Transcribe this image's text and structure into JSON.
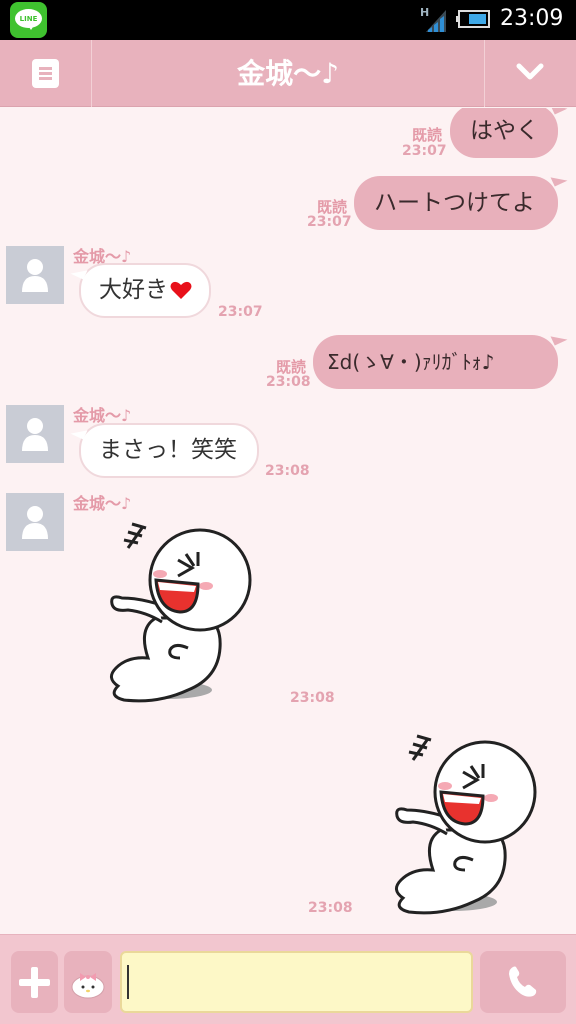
{
  "status_bar": {
    "app_icon_label": "LINE",
    "network_type": "H",
    "time": "23:09"
  },
  "header": {
    "title": "金城～♪",
    "menu_icon": "menu-icon",
    "dropdown_icon": "chevron-down-icon"
  },
  "colors": {
    "header": "#e8b2bd",
    "outgoing_bubble": "#e8b0bb",
    "chat_background": "#fdf2f3",
    "input_background": "#fdf8c7",
    "line_green": "#3fc22f"
  },
  "messages": [
    {
      "direction": "out",
      "read": "既読",
      "time": "23:07",
      "text": "はやく"
    },
    {
      "direction": "out",
      "read": "既読",
      "time": "23:07",
      "text": "ハートつけてよ"
    },
    {
      "direction": "in",
      "sender": "金城～♪",
      "time": "23:07",
      "text": "大好き",
      "icon": "heart-icon"
    },
    {
      "direction": "out",
      "read": "既読",
      "time": "23:08",
      "text": "Σd(ゝ∀・)ｧﾘｶﾞﾄｫ♪"
    },
    {
      "direction": "in",
      "sender": "金城～♪",
      "time": "23:08",
      "text": "まさっ！笑笑"
    },
    {
      "direction": "in",
      "sender": "金城～♪",
      "time": "23:08",
      "sticker": "laughing-sticker"
    },
    {
      "direction": "out",
      "time": "23:08",
      "sticker": "laughing-sticker"
    }
  ],
  "footer": {
    "input_value": "",
    "plus_icon": "plus-icon",
    "sticker_icon": "my-melody-icon",
    "call_icon": "phone-icon"
  }
}
